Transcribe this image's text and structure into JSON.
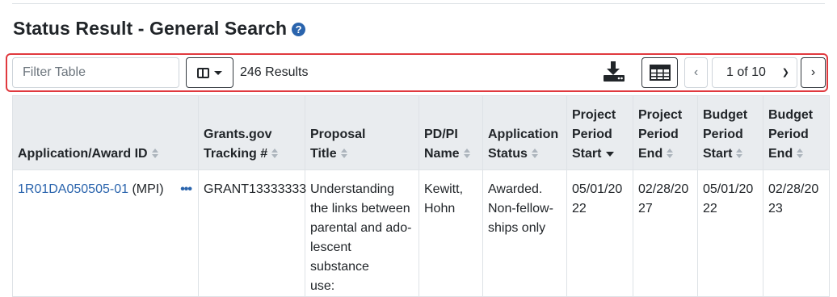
{
  "page": {
    "title": "Status Result - General Search",
    "help_icon": "question-circle-icon"
  },
  "toolbar": {
    "filter_placeholder": "Filter Table",
    "columns_icon": "columns-icon",
    "results_count": "246 Results",
    "download_icon": "download-icon",
    "grid_icon": "table-grid-icon",
    "prev_label": "‹",
    "page_select": "1 of 10",
    "next_label": "›"
  },
  "colors": {
    "accent_border": "#e0393e",
    "link": "#2a64ad",
    "header_bg": "#e9ecef"
  },
  "table": {
    "headers": [
      {
        "line1": "Application/Award ID",
        "line2": "",
        "line3": ""
      },
      {
        "line1": "Grants.gov",
        "line2": "Tracking #",
        "line3": ""
      },
      {
        "line1": "Proposal",
        "line2": "Title",
        "line3": ""
      },
      {
        "line1": "PD/PI",
        "line2": "Name",
        "line3": ""
      },
      {
        "line1": "Application",
        "line2": "Status",
        "line3": ""
      },
      {
        "line1": "Project",
        "line2": "Period",
        "line3": "Start"
      },
      {
        "line1": "Project",
        "line2": "Period",
        "line3": "End"
      },
      {
        "line1": "Budget",
        "line2": "Period",
        "line3": "Start"
      },
      {
        "line1": "Budget",
        "line2": "Period",
        "line3": "End"
      }
    ],
    "rows": [
      {
        "app_id": "1R01DA050505-01",
        "app_suffix": " (MPI)",
        "more": "•••",
        "tracking": "GRANT13333333",
        "title_l1": "Understanding",
        "title_l2": "the links between",
        "title_l3": "parental and ado-",
        "title_l4": "lescent substance",
        "title_l5": "use:",
        "pi_l1": "Kewitt,",
        "pi_l2": "Hohn",
        "status_l1": "Awarded.",
        "status_l2": "Non-fellow-",
        "status_l3": "ships only",
        "proj_start_l1": "05/01/20",
        "proj_start_l2": "22",
        "proj_end_l1": "02/28/20",
        "proj_end_l2": "27",
        "bud_start_l1": "05/01/20",
        "bud_start_l2": "22",
        "bud_end_l1": "02/28/20",
        "bud_end_l2": "23"
      }
    ]
  }
}
